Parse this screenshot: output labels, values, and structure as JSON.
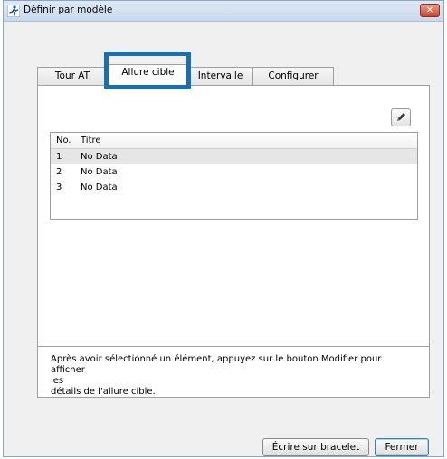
{
  "window": {
    "title": "Définir par modèle",
    "close_symbol": "✕"
  },
  "tabs": [
    {
      "label": "Tour AT"
    },
    {
      "label": "Allure cible"
    },
    {
      "label": "Intervalle"
    },
    {
      "label": "Configurer"
    }
  ],
  "list": {
    "columns": {
      "no": "No.",
      "title": "Titre"
    },
    "rows": [
      {
        "no": "1",
        "title": "No Data"
      },
      {
        "no": "2",
        "title": "No Data"
      },
      {
        "no": "3",
        "title": "No Data"
      }
    ]
  },
  "help": {
    "line1": "Après avoir sélectionné un élément, appuyez sur le bouton Modifier pour afficher",
    "line2": "les",
    "line3": "détails de l'allure cible."
  },
  "buttons": {
    "write": "Écrire sur bracelet",
    "close": "Fermer"
  },
  "colors": {
    "highlight": "#1a6fae",
    "close_button": "#c9462c"
  }
}
